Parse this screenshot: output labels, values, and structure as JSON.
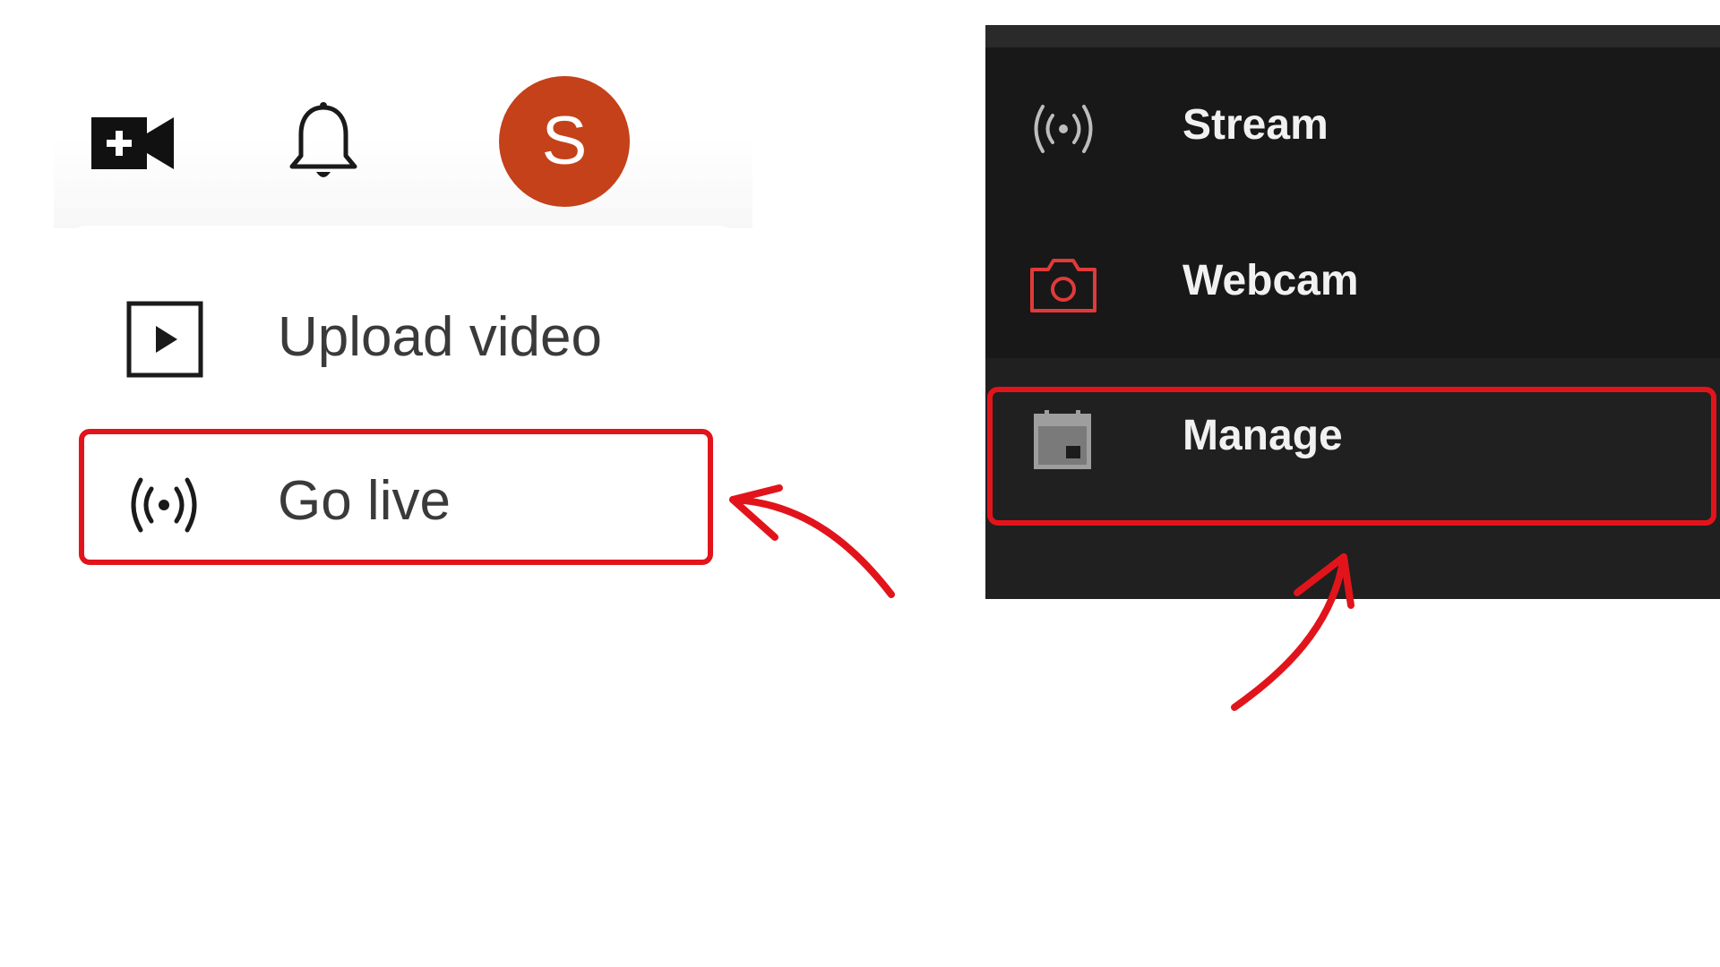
{
  "left": {
    "topbar": {
      "create_icon": "video-camera-plus-icon",
      "notifications_icon": "bell-icon",
      "avatar_letter": "S",
      "avatar_color": "#c4411a"
    },
    "menu": {
      "items": [
        {
          "label": "Upload video",
          "icon": "play-square-icon"
        },
        {
          "label": "Go live",
          "icon": "broadcast-icon"
        }
      ]
    }
  },
  "right": {
    "menu": {
      "items": [
        {
          "label": "Stream",
          "icon": "broadcast-icon"
        },
        {
          "label": "Webcam",
          "icon": "camera-icon",
          "icon_color": "#e03a3a"
        },
        {
          "label": "Manage",
          "icon": "calendar-icon"
        }
      ]
    }
  },
  "annotations": {
    "highlight_color": "#e2141b",
    "highlighted_items": [
      "Go live",
      "Manage"
    ]
  }
}
